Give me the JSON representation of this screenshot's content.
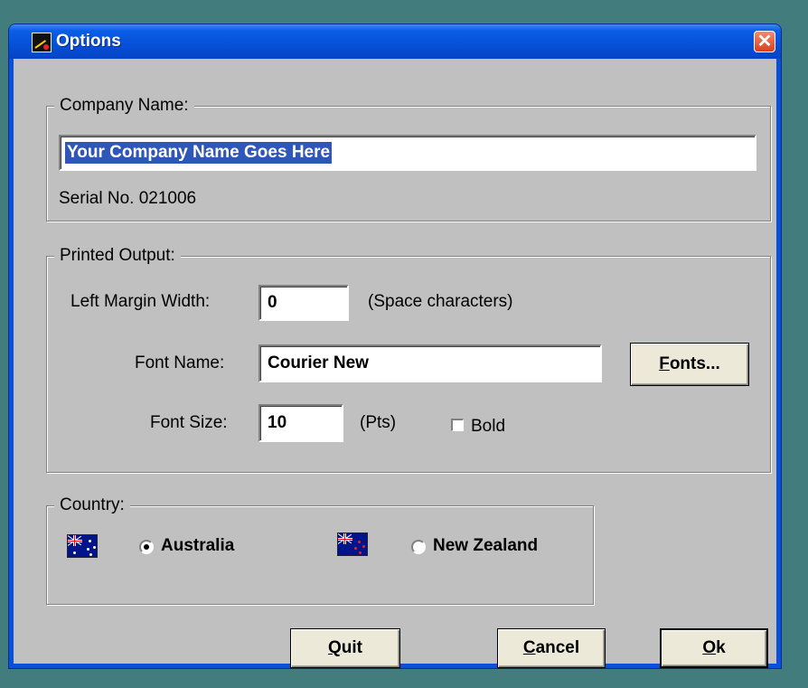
{
  "window": {
    "title": "Options",
    "close_glyph": "✕"
  },
  "company": {
    "group_label": "Company Name:",
    "name_value": "Your Company Name Goes Here",
    "serial_text": "Serial No. 021006"
  },
  "printed": {
    "group_label": "Printed Output:",
    "margin_label": "Left Margin Width:",
    "margin_value": "0",
    "margin_hint": "(Space characters)",
    "font_name_label": "Font Name:",
    "font_name_value": "Courier New",
    "fonts_button": {
      "accel": "F",
      "rest": "onts..."
    },
    "font_size_label": "Font Size:",
    "font_size_value": "10",
    "font_size_unit": "(Pts)",
    "bold_label": "Bold",
    "bold_checked": false
  },
  "country": {
    "group_label": "Country:",
    "options": [
      {
        "label": "Australia",
        "selected": true,
        "flag_icon": "australia-flag-icon"
      },
      {
        "label": "New Zealand",
        "selected": false,
        "flag_icon": "new-zealand-flag-icon"
      }
    ]
  },
  "buttons": {
    "quit": {
      "accel": "Q",
      "rest": "uit"
    },
    "cancel": {
      "accel": "C",
      "rest": "ancel"
    },
    "ok": {
      "accel": "O",
      "rest": "k"
    }
  },
  "colors": {
    "titlebar": "#0650d8",
    "desktop": "#427c7c",
    "dialog_face": "#c0c0c0",
    "selection": "#2e57b8",
    "close_button": "#d8401e"
  }
}
